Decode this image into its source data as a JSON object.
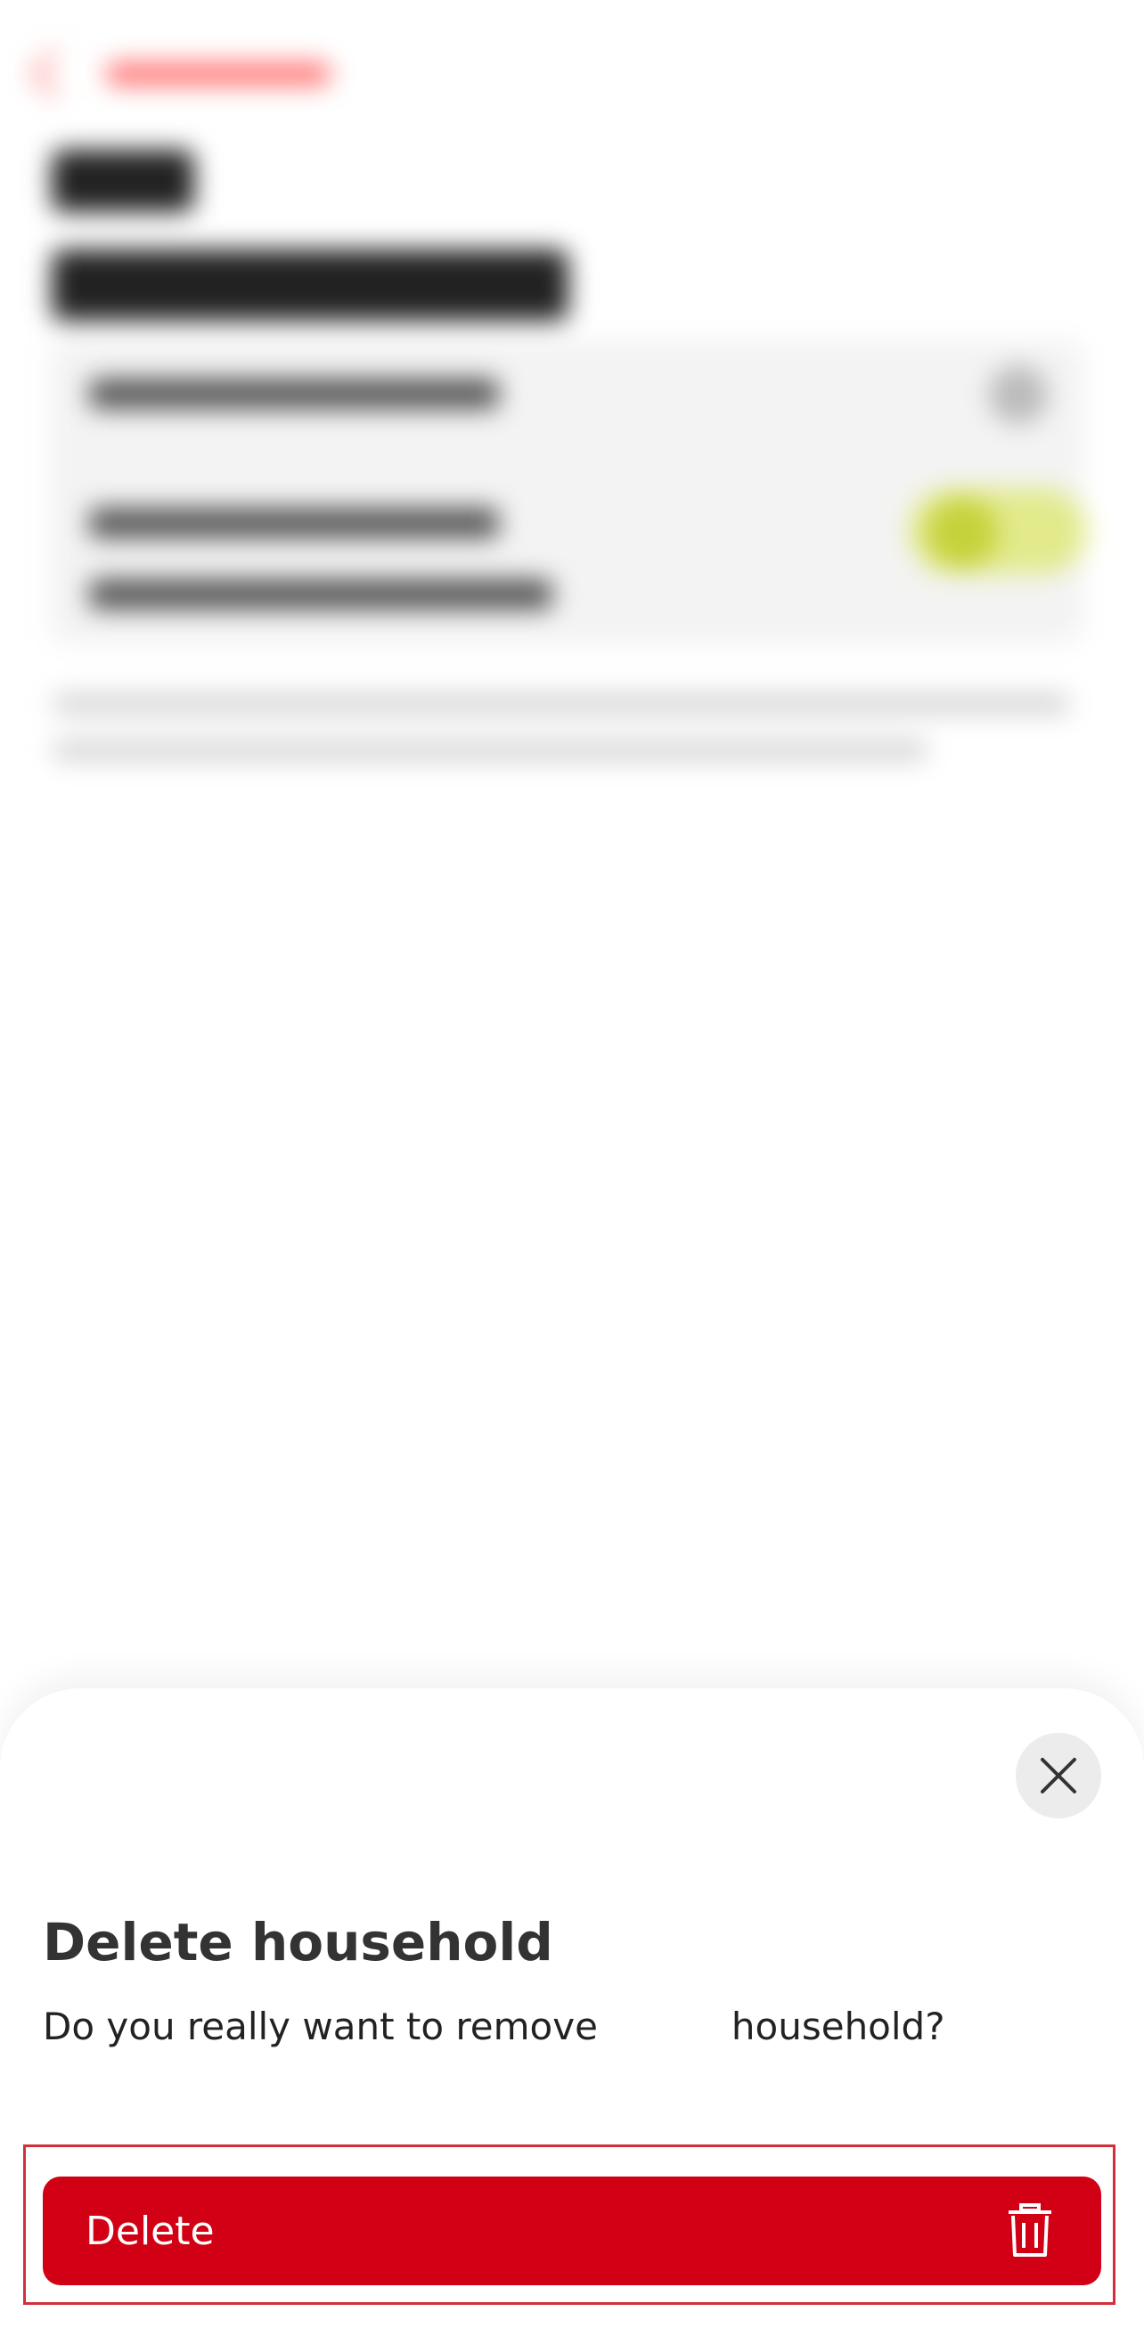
{
  "dialog": {
    "title": "Delete household",
    "message_before": "Do you really want to remove",
    "message_after": "household?",
    "delete_label": "Delete",
    "close_icon": "close-icon",
    "trash_icon": "trash-icon"
  },
  "colors": {
    "primary": "#d10014",
    "highlight_frame": "#d0303b",
    "close_bg": "#ececec",
    "text": "#333333"
  }
}
